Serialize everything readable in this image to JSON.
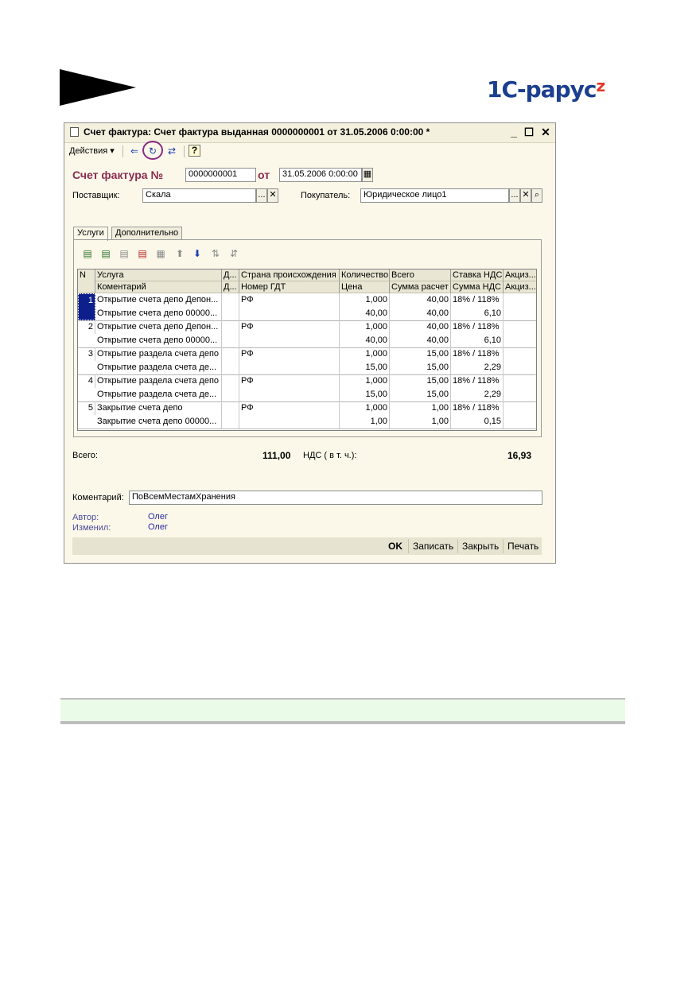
{
  "window": {
    "title": "Счет фактура: Счет фактура выданная 0000000001 от 31.05.2006 0:00:00 *",
    "controls": {
      "minimize": "_",
      "maximize": "☐",
      "close": "✕"
    }
  },
  "toolbar": {
    "actions_label": "Действия",
    "help_label": "?"
  },
  "form": {
    "doc_title": "Счет фактура №",
    "number": "0000000001",
    "ot_label": "от",
    "date": "31.05.2006  0:00:00",
    "supplier_label": "Поставщик:",
    "supplier_value": "Скала",
    "buyer_label": "Покупатель:",
    "buyer_value": "Юридическое лицо1",
    "select_button": "...",
    "clear_button": "✕",
    "search_icon_char": "⌕"
  },
  "tabs": [
    {
      "label": "Услуги",
      "active": true
    },
    {
      "label": "Дополнительно",
      "active": false
    }
  ],
  "grid": {
    "headers_top": [
      "N",
      "Услуга",
      "Д...",
      "Страна происхождения",
      "Количество",
      "Всего",
      "Ставка НДС",
      "Акциз..."
    ],
    "headers_bottom": [
      "",
      "Коментарий",
      "Д...",
      "Номер ГДТ",
      "Цена",
      "Сумма расчет",
      "Сумма НДС",
      "Акциз..."
    ],
    "rows": [
      {
        "n": "1",
        "service": "Открытие счета депо Депон...",
        "comment": "Открытие счета депо 00000...",
        "country": "РФ",
        "gtd": "",
        "qty": "1,000",
        "price": "40,00",
        "total": "40,00",
        "sum_calc": "40,00",
        "vat_rate": "18% / 118%",
        "vat_sum": "6,10",
        "selected": true
      },
      {
        "n": "2",
        "service": "Открытие счета депо Депон...",
        "comment": "Открытие счета депо 00000...",
        "country": "РФ",
        "gtd": "",
        "qty": "1,000",
        "price": "40,00",
        "total": "40,00",
        "sum_calc": "40,00",
        "vat_rate": "18% / 118%",
        "vat_sum": "6,10",
        "selected": false
      },
      {
        "n": "3",
        "service": "Открытие раздела счета депо",
        "comment": "Открытие раздела счета де...",
        "country": "РФ",
        "gtd": "",
        "qty": "1,000",
        "price": "15,00",
        "total": "15,00",
        "sum_calc": "15,00",
        "vat_rate": "18% / 118%",
        "vat_sum": "2,29",
        "selected": false
      },
      {
        "n": "4",
        "service": "Открытие раздела счета депо",
        "comment": "Открытие раздела счета де...",
        "country": "РФ",
        "gtd": "",
        "qty": "1,000",
        "price": "15,00",
        "total": "15,00",
        "sum_calc": "15,00",
        "vat_rate": "18% / 118%",
        "vat_sum": "2,29",
        "selected": false
      },
      {
        "n": "5",
        "service": "Закрытие счета депо",
        "comment": "Закрытие счета депо 00000...",
        "country": "РФ",
        "gtd": "",
        "qty": "1,000",
        "price": "1,00",
        "total": "1,00",
        "sum_calc": "1,00",
        "vat_rate": "18% / 118%",
        "vat_sum": "0,15",
        "selected": false
      }
    ]
  },
  "totals": {
    "total_label": "Всего:",
    "total_value": "111,00",
    "vat_label": "НДС ( в т. ч.):",
    "vat_value": "16,93"
  },
  "footer": {
    "comment_label": "Коментарий:",
    "comment_value": "ПоВсемМестамХранения",
    "author_label": "Автор:",
    "author_value": "Олег",
    "modified_label": "Изменил:",
    "modified_value": "Олег"
  },
  "buttons": {
    "ok": "OK",
    "save": "Записать",
    "close": "Закрыть",
    "print": "Печать"
  },
  "logo": {
    "main": "1С-рарус",
    "mark": "z"
  },
  "colors": {
    "doc_title": "#8a2b4f",
    "selection": "#0d1f8a",
    "highlight_circle": "#8a2b86",
    "band": "#eafbe7"
  }
}
